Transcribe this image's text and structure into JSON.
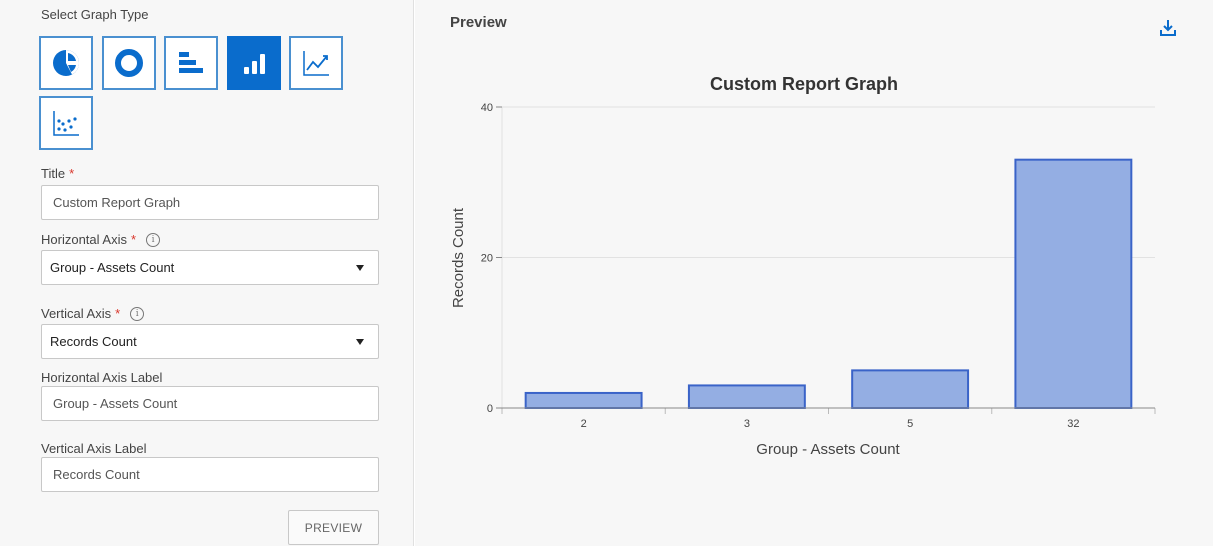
{
  "form": {
    "select_graph_type_label": "Select Graph Type",
    "graph_types": [
      {
        "name": "pie",
        "selected": false
      },
      {
        "name": "donut",
        "selected": false
      },
      {
        "name": "horizontal-bar",
        "selected": false
      },
      {
        "name": "vertical-bar",
        "selected": true
      },
      {
        "name": "line",
        "selected": false
      },
      {
        "name": "scatter",
        "selected": false
      }
    ],
    "title_label": "Title",
    "title_value": "Custom Report Graph",
    "horizontal_axis_label": "Horizontal Axis",
    "horizontal_axis_value": "Group - Assets Count",
    "vertical_axis_label": "Vertical Axis",
    "vertical_axis_value": "Records Count",
    "horizontal_axis_label_label": "Horizontal Axis Label",
    "horizontal_axis_label_value": "Group - Assets Count",
    "vertical_axis_label_label": "Vertical Axis Label",
    "vertical_axis_label_value": "Records Count",
    "required_mark": "*",
    "info_glyph": "i",
    "preview_button": "PREVIEW"
  },
  "preview": {
    "title": "Preview",
    "download_icon": "download-icon"
  },
  "colors": {
    "accent": "#0a6ccc",
    "bar_fill": "#94aee3",
    "bar_stroke": "#3a63c8"
  },
  "chart_data": {
    "type": "bar",
    "title": "Custom Report Graph",
    "xlabel": "Group - Assets Count",
    "ylabel": "Records Count",
    "categories": [
      "2",
      "3",
      "5",
      "32"
    ],
    "values": [
      2,
      3,
      5,
      33
    ],
    "ylim": [
      0,
      40
    ],
    "yticks": [
      0,
      20,
      40
    ],
    "grid": true
  }
}
